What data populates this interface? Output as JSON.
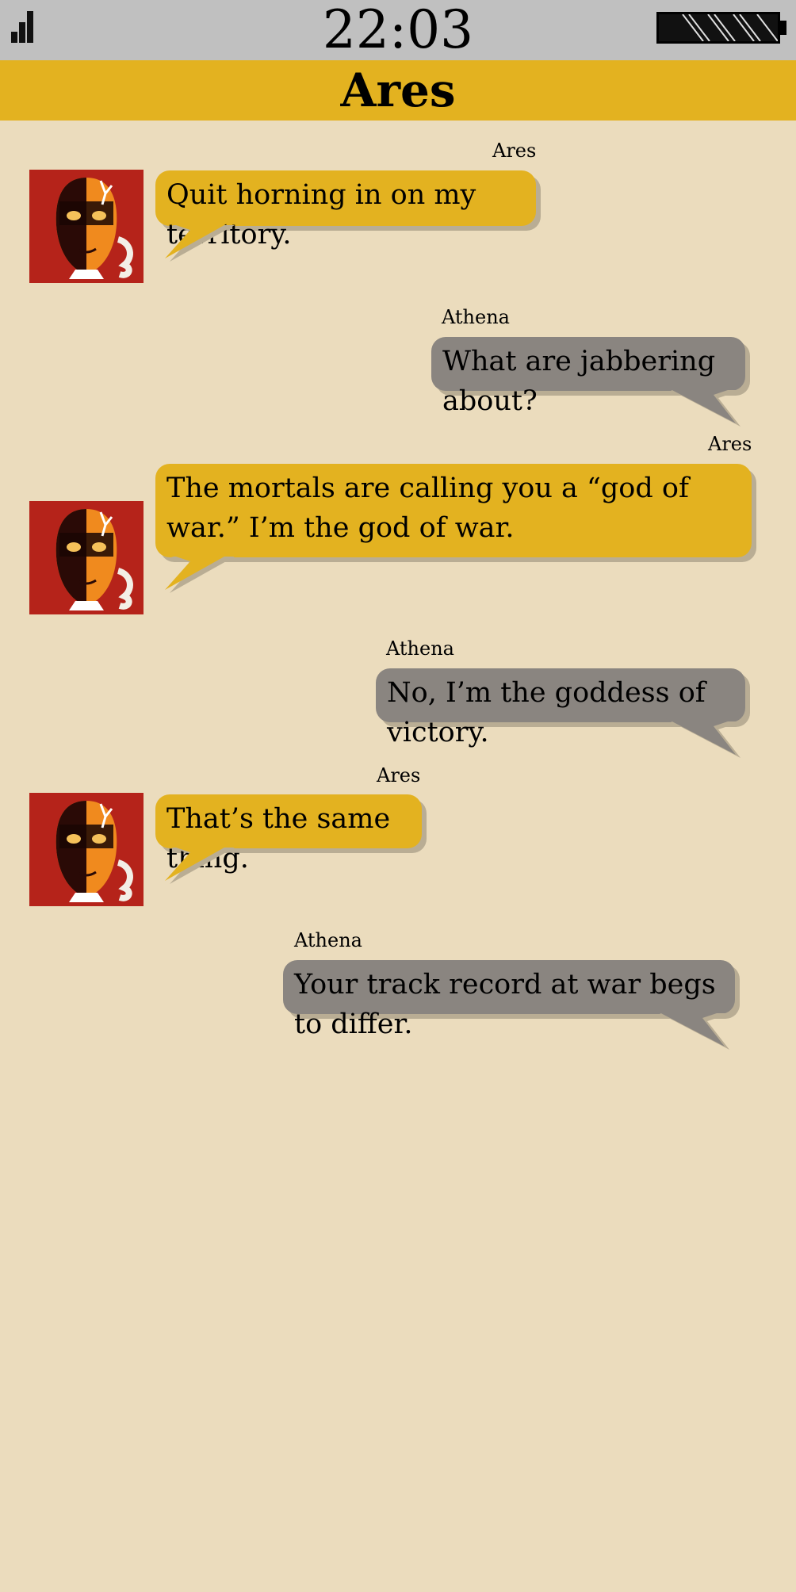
{
  "status": {
    "time": "22:03"
  },
  "header": {
    "title": "Ares"
  },
  "colors": {
    "ares_bubble": "#e3b220",
    "athena_bubble": "#8a8580",
    "background": "#ebdcbd"
  },
  "messages": [
    {
      "sender": "Ares",
      "text": "Quit horning in on my territory."
    },
    {
      "sender": "Athena",
      "text": "What are jabbering about?"
    },
    {
      "sender": "Ares",
      "text": "The mortals are calling you a “god of war.” I’m the god of war."
    },
    {
      "sender": "Athena",
      "text": "No, I’m the goddess of victory."
    },
    {
      "sender": "Ares",
      "text": "That’s the same thing."
    },
    {
      "sender": "Athena",
      "text": "Your track record at war begs to differ."
    }
  ]
}
